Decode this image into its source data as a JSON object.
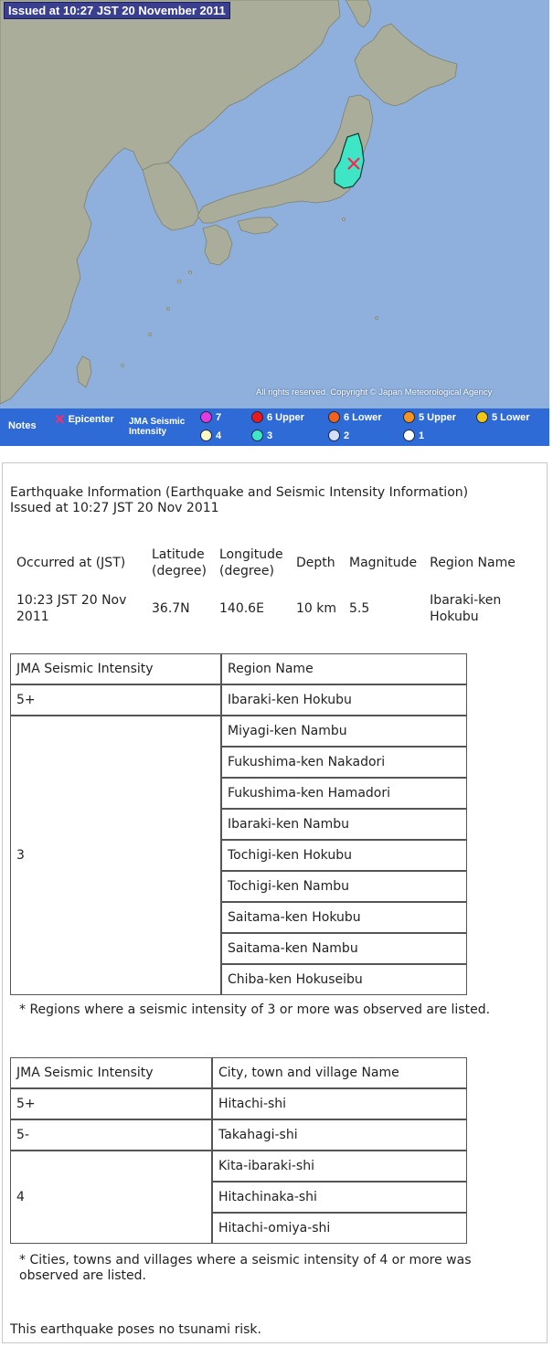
{
  "map": {
    "issued_label": "Issued at 10:27 JST  20 November 2011",
    "copyright": "All rights reserved. Copyright © Japan Meteorological Agency",
    "colors": {
      "sea": "#8fb0dc",
      "land": "#a9ad9a",
      "epicenter_region": "#3fe6c6"
    }
  },
  "legend": {
    "notes": "Notes",
    "epicenter": "Epicenter",
    "epicenter_icon": "x-icon",
    "jma_line1": "JMA Seismic",
    "jma_line2": "Intensity",
    "items": [
      {
        "label": "7",
        "color": "#e23be0"
      },
      {
        "label": "6 Upper",
        "color": "#e8191c"
      },
      {
        "label": "6 Lower",
        "color": "#f2621e"
      },
      {
        "label": "5 Upper",
        "color": "#f6931e"
      },
      {
        "label": "5 Lower",
        "color": "#f3c614"
      },
      {
        "label": "4",
        "color": "#fbf6c4"
      },
      {
        "label": "3",
        "color": "#3fe6c6"
      },
      {
        "label": "2",
        "color": "#d4e0f7"
      },
      {
        "label": "1",
        "color": "#ffffff"
      }
    ]
  },
  "info": {
    "title_line1": "Earthquake Information (Earthquake and Seismic Intensity Information)",
    "title_line2": "Issued at 10:27 JST 20 Nov 2011",
    "headers": {
      "occurred": "Occurred at (JST)",
      "latitude": "Latitude (degree)",
      "longitude": "Longitude (degree)",
      "depth": "Depth",
      "magnitude": "Magnitude",
      "region": "Region Name"
    },
    "values": {
      "occurred": "10:23 JST 20 Nov 2011",
      "latitude": "36.7N",
      "longitude": "140.6E",
      "depth": "10 km",
      "magnitude": "5.5",
      "region": "Ibaraki-ken Hokubu"
    }
  },
  "region_table": {
    "headers": [
      "JMA Seismic Intensity",
      "Region Name"
    ],
    "groups": [
      {
        "intensity": "5+",
        "names": [
          "Ibaraki-ken Hokubu"
        ]
      },
      {
        "intensity": "3",
        "names": [
          "Miyagi-ken Nambu",
          "Fukushima-ken Nakadori",
          "Fukushima-ken Hamadori",
          "Ibaraki-ken Nambu",
          "Tochigi-ken Hokubu",
          "Tochigi-ken Nambu",
          "Saitama-ken Hokubu",
          "Saitama-ken Nambu",
          "Chiba-ken Hokuseibu"
        ]
      }
    ],
    "note": "* Regions where a seismic intensity of 3 or more was observed are listed."
  },
  "city_table": {
    "headers": [
      "JMA Seismic Intensity",
      "City, town and village Name"
    ],
    "groups": [
      {
        "intensity": "5+",
        "names": [
          "Hitachi-shi"
        ]
      },
      {
        "intensity": "5-",
        "names": [
          "Takahagi-shi"
        ]
      },
      {
        "intensity": "4",
        "names": [
          "Kita-ibaraki-shi",
          "Hitachinaka-shi",
          "Hitachi-omiya-shi"
        ]
      }
    ],
    "note_line1": "* Cities, towns and villages where a seismic intensity of 4 or more was",
    "note_line2": "observed are listed."
  },
  "tsunami": "This earthquake poses no tsunami risk."
}
